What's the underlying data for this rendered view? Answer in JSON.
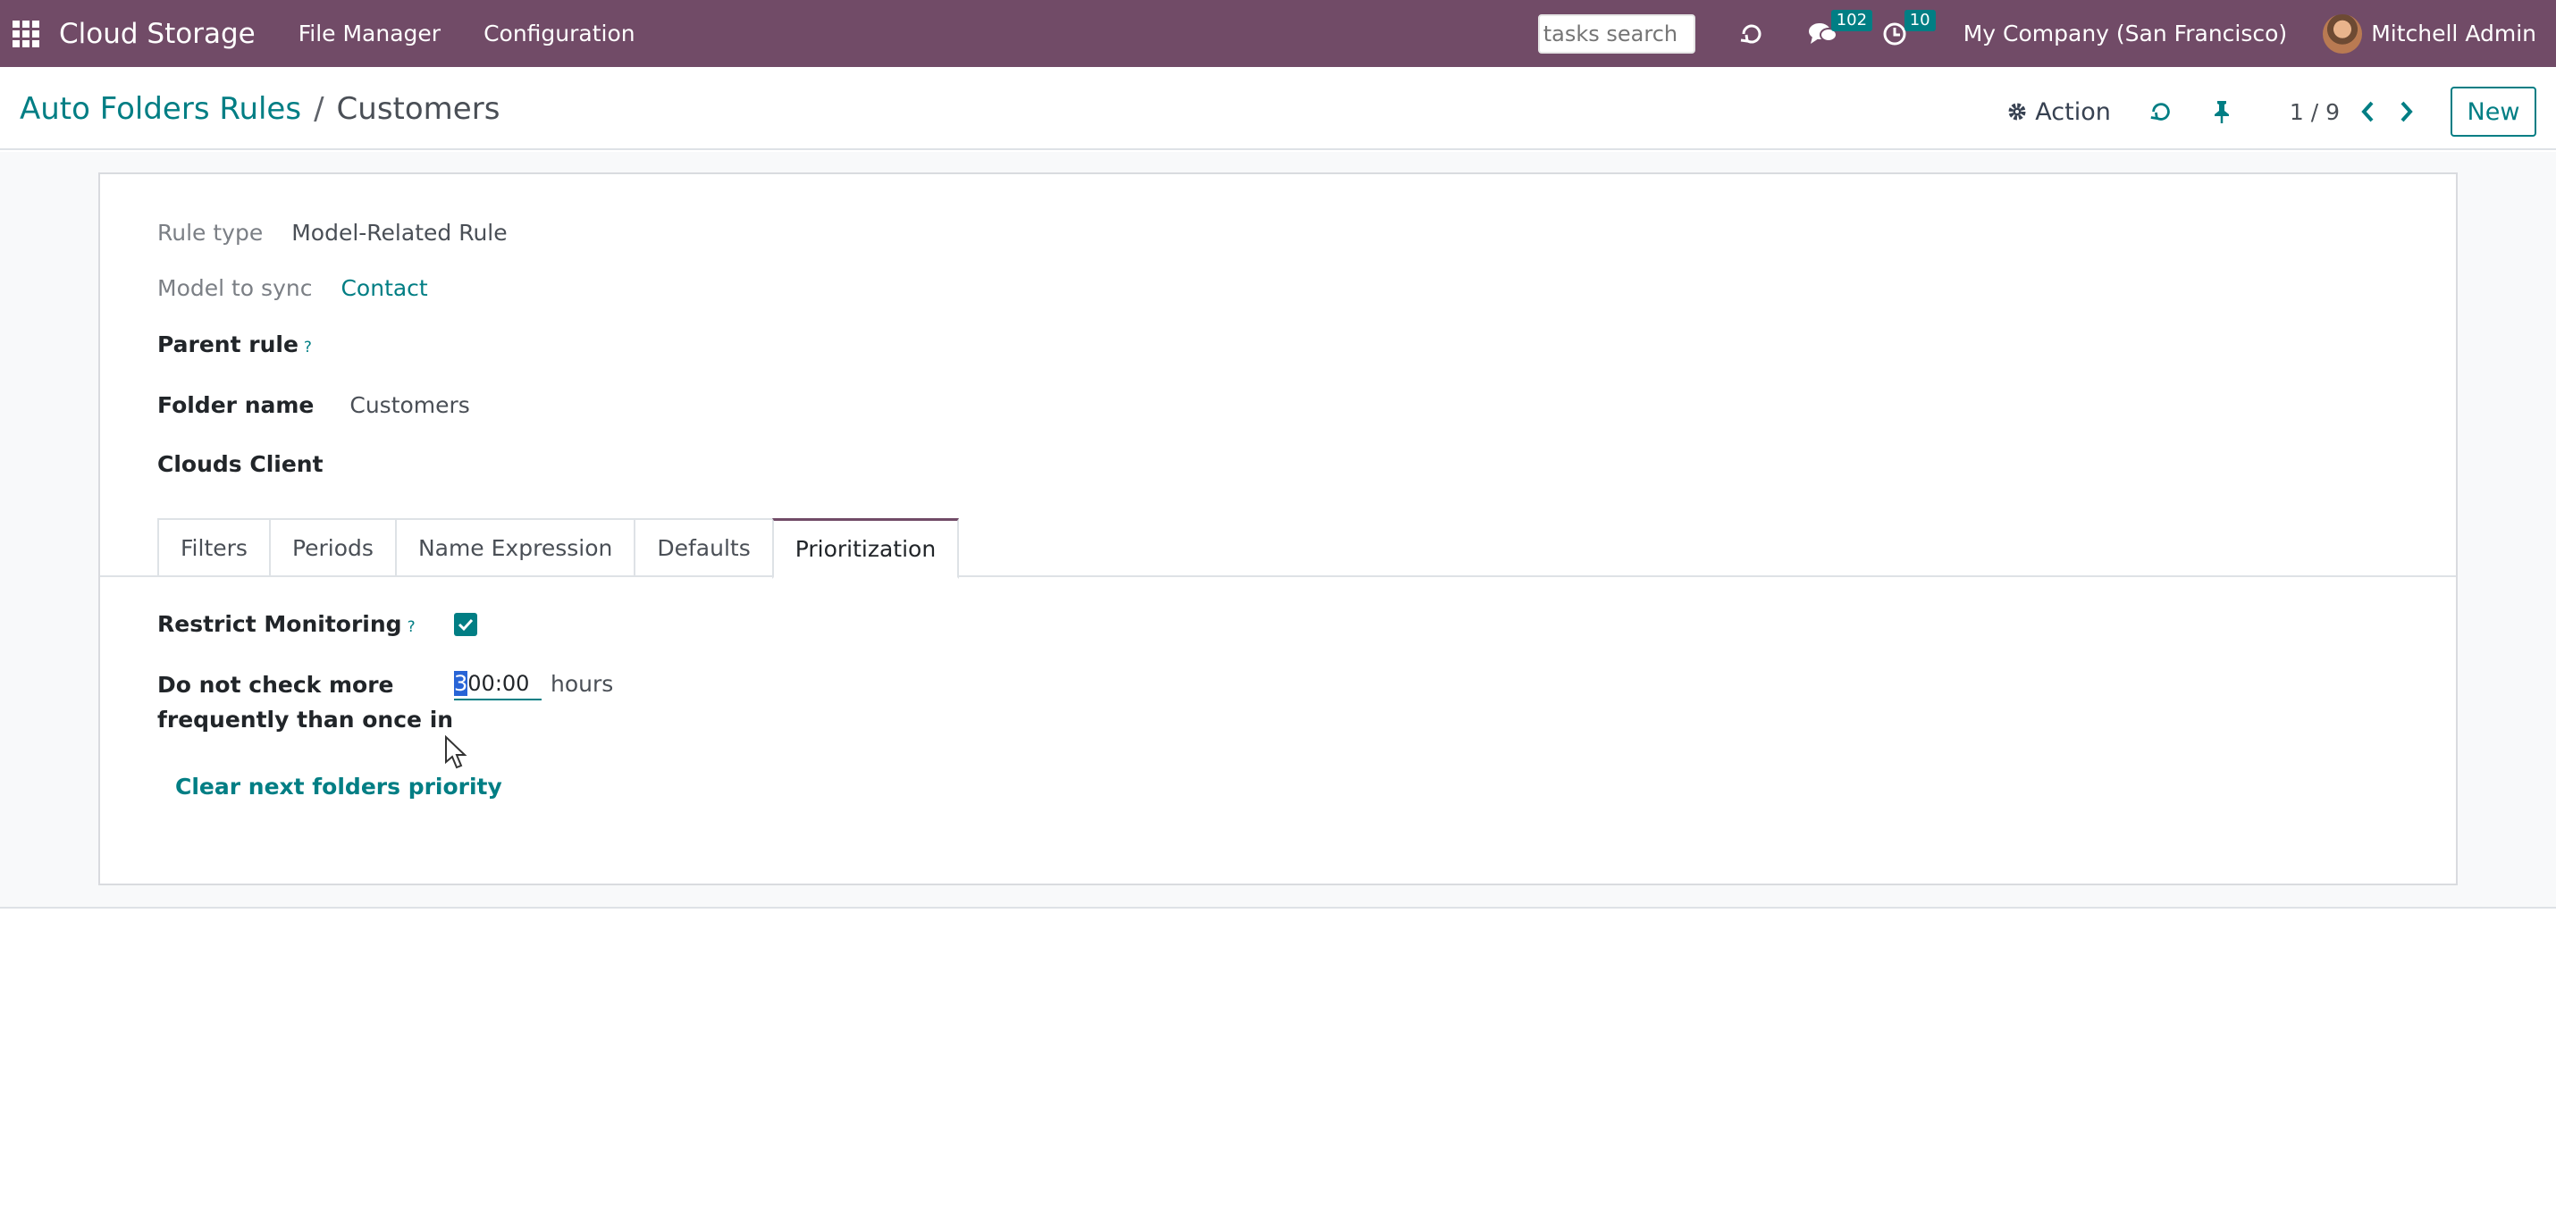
{
  "topnav": {
    "app_title": "Cloud Storage",
    "menu": [
      "File Manager",
      "Configuration"
    ],
    "search_placeholder": "tasks search",
    "messages_count": "102",
    "activities_count": "10",
    "company": "My Company (San Francisco)",
    "user": "Mitchell Admin"
  },
  "control": {
    "breadcrumb_parent": "Auto Folders Rules",
    "breadcrumb_separator": "/",
    "breadcrumb_current": "Customers",
    "action_label": "Action",
    "pager": "1 / 9",
    "new_label": "New"
  },
  "form": {
    "rule_type_label": "Rule type",
    "rule_type_value": "Model-Related Rule",
    "model_label": "Model to sync",
    "model_value": "Contact",
    "parent_rule_label": "Parent rule",
    "help_mark": "?",
    "folder_name_label": "Folder name",
    "folder_name_value": "Customers",
    "clouds_client_label": "Clouds Client",
    "tabs": [
      "Filters",
      "Periods",
      "Name Expression",
      "Defaults",
      "Prioritization"
    ],
    "active_tab": "Prioritization",
    "restrict_label": "Restrict Monitoring",
    "restrict_checked": true,
    "frequency_label_line1": "Do not check more",
    "frequency_label_line2": "frequently than once in",
    "frequency_value_selected": "3",
    "frequency_value_rest": "00:00",
    "hours_label": "hours",
    "clear_link": "Clear next folders priority"
  },
  "colors": {
    "brand": "#714b67",
    "accent": "#017e84"
  }
}
